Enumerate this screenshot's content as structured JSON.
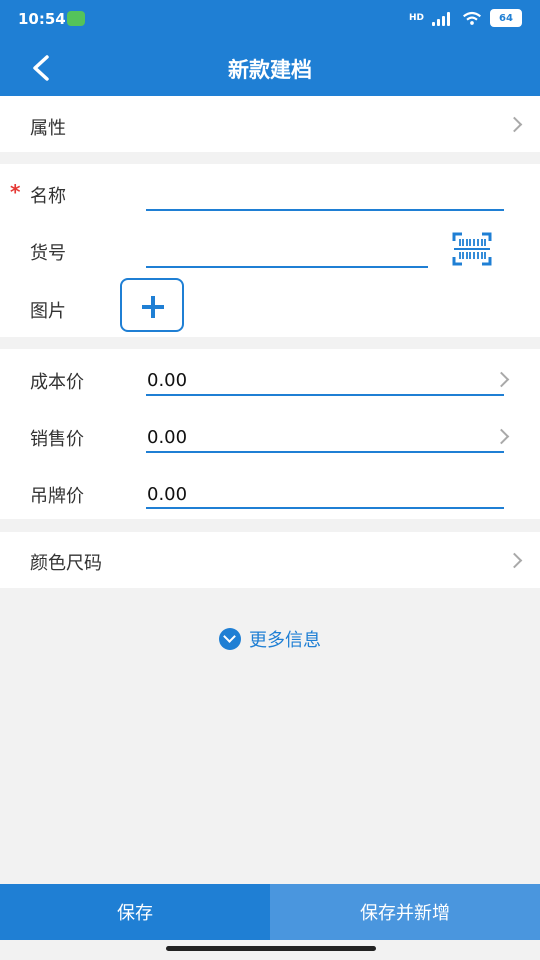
{
  "status_bar": {
    "time": "10:54",
    "battery": "64",
    "network": "HD"
  },
  "header": {
    "title": "新款建档"
  },
  "form": {
    "attribute_label": "属性",
    "name_label": "名称",
    "required_mark": "*",
    "sku_label": "货号",
    "image_label": "图片",
    "cost_label": "成本价",
    "cost_value": "0.00",
    "sale_label": "销售价",
    "sale_value": "0.00",
    "tag_label": "吊牌价",
    "tag_value": "0.00",
    "color_size_label": "颜色尺码",
    "more_info_label": "更多信息"
  },
  "footer": {
    "save_label": "保存",
    "save_new_label": "保存并新增"
  },
  "colors": {
    "primary": "#1f7fd4",
    "secondary_button": "#4a96de",
    "required": "#e53935",
    "background": "#f2f2f2"
  }
}
